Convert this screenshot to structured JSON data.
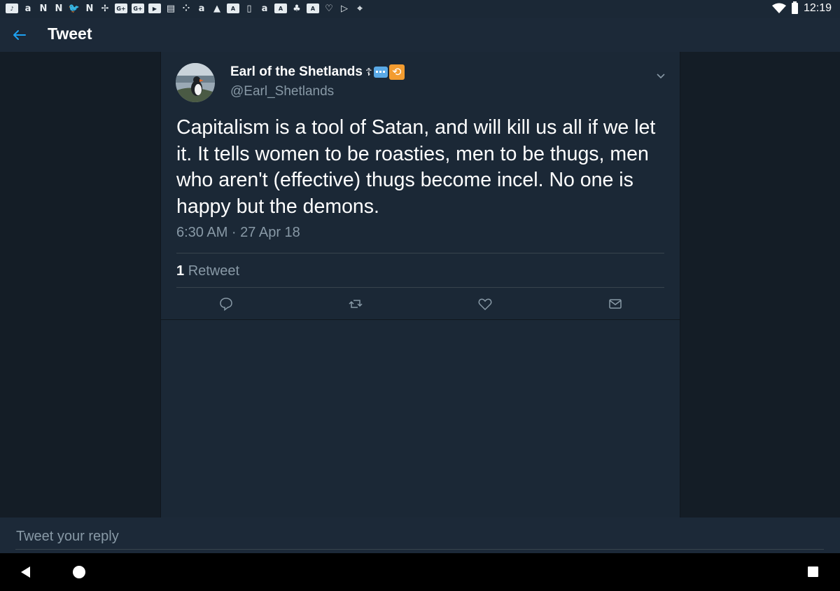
{
  "status_bar": {
    "time": "12:19",
    "notification_icons": [
      "music",
      "a",
      "N",
      "N",
      "bird",
      "N",
      "pinwheel",
      "G+",
      "G+",
      "play",
      "news",
      "dots",
      "a",
      "photo",
      "A",
      "phone",
      "a",
      "A",
      "tree",
      "A",
      "heart",
      "play-store",
      "map"
    ]
  },
  "app_bar": {
    "title": "Tweet"
  },
  "tweet": {
    "author_name": "Earl of the Shetlands",
    "author_badges": "☦💬🔁",
    "handle": "@Earl_Shetlands",
    "text": "Capitalism is a tool of Satan, and will kill us all if we let it. It tells women to be roasties, men to be thugs, men who aren't (effective) thugs become incel. No one is happy but the demons.",
    "timestamp": "6:30 AM · 27 Apr 18",
    "retweet_count": "1",
    "retweet_label": "Retweet"
  },
  "reply": {
    "placeholder": "Tweet your reply"
  },
  "colors": {
    "background": "#141d26",
    "panel": "#1b2836",
    "accent": "#1da1f2",
    "muted": "#8899a6"
  },
  "icons": {
    "back": "arrow-left-icon",
    "reply": "reply-icon",
    "retweet": "retweet-icon",
    "like": "heart-icon",
    "dm": "envelope-icon",
    "more": "chevron-down-icon"
  }
}
